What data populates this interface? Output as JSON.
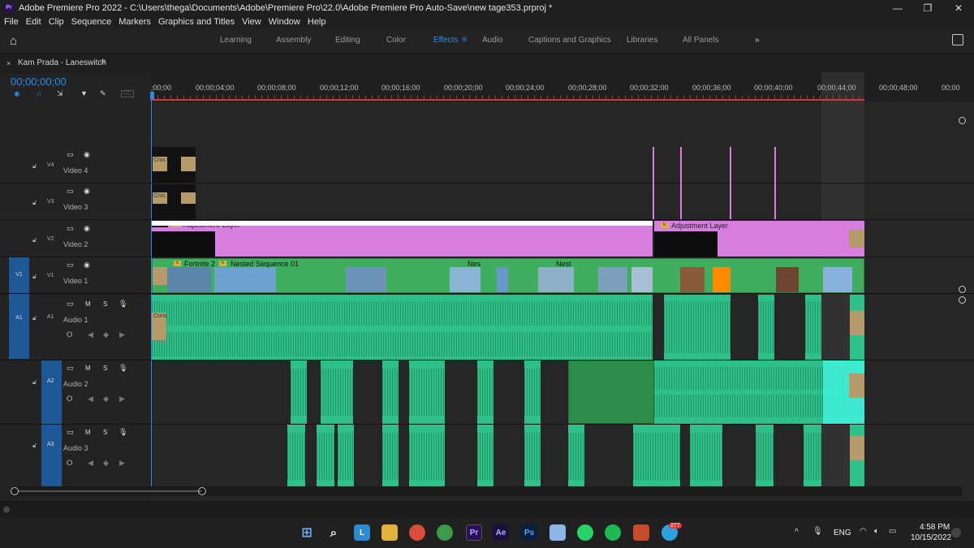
{
  "window": {
    "title": "Adobe Premiere Pro 2022 - C:\\Users\\thega\\Documents\\Adobe\\Premiere Pro\\22.0\\Adobe Premiere Pro Auto-Save\\new tage353.prproj *",
    "logo": "Pr"
  },
  "menu": [
    "File",
    "Edit",
    "Clip",
    "Sequence",
    "Markers",
    "Graphics and Titles",
    "View",
    "Window",
    "Help"
  ],
  "workspaces": [
    "Learning",
    "Assembly",
    "Editing",
    "Color",
    "Effects",
    "Audio",
    "Captions and Graphics",
    "Libraries",
    "All Panels"
  ],
  "active_workspace": "Effects",
  "panel": {
    "tab": "Kam Prada - Laneswitch",
    "timecode": "00;00;00;00"
  },
  "ruler": [
    ";00;00",
    "00;00;04;00",
    "00;00;08;00",
    "00;00;12;00",
    "00;00;16;00",
    "00;00;20;00",
    "00;00;24;00",
    "00;00;28;00",
    "00;00;32;00",
    "00;00;36;00",
    "00;00;40;00",
    "00;00;44;00",
    "00;00;48;00",
    "00;00"
  ],
  "tracks": {
    "video": [
      {
        "id": "V4",
        "name": "Video 4"
      },
      {
        "id": "V3",
        "name": "Video 3"
      },
      {
        "id": "V2",
        "name": "Video 2"
      },
      {
        "id": "V1",
        "name": "Video 1",
        "target": "V1"
      }
    ],
    "audio": [
      {
        "id": "A1",
        "name": "Audio 1",
        "target": "A1"
      },
      {
        "id": "A2",
        "name": "Audio 2"
      },
      {
        "id": "A3",
        "name": "Audio 3"
      }
    ]
  },
  "clips": {
    "adjustment": "Adjustment Layer",
    "fortnite": "Fortnite 2",
    "nested": "Nested Sequence 01",
    "nes": "Nes",
    "nest": "Nest",
    "cross": "Cros",
    "cons": "Cons"
  },
  "taskbar": {
    "lang": "ENG",
    "time": "4:58 PM",
    "date": "10/15/2022",
    "badge": "277"
  },
  "colors": {
    "accent": "#2d8ceb",
    "adjustment": "#d77fe0",
    "video_clip": "#3fae5f",
    "audio_clip": "#2fc08a",
    "playhead": "#e03333"
  }
}
